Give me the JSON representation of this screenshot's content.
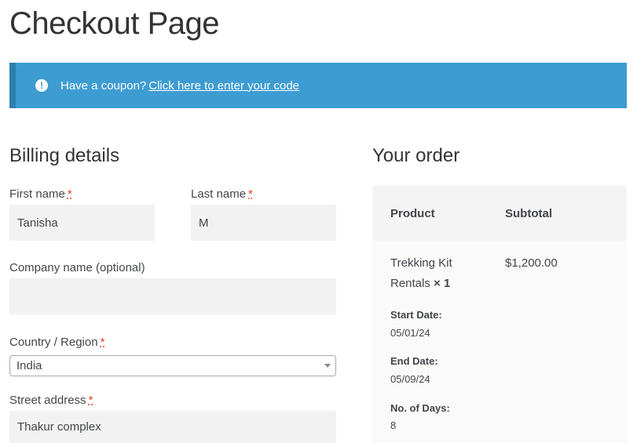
{
  "page": {
    "title": "Checkout Page"
  },
  "notice": {
    "icon": "exclamation-icon",
    "text": "Have a coupon?",
    "link": "Click here to enter your code",
    "bg_color": "#3d9cd2"
  },
  "billing": {
    "title": "Billing details",
    "required_marker": "*",
    "first_name": {
      "label": "First name",
      "value": "Tanisha"
    },
    "last_name": {
      "label": "Last name",
      "value": "M"
    },
    "company": {
      "label": "Company name (optional)",
      "value": ""
    },
    "country": {
      "label": "Country / Region",
      "value": "India"
    },
    "street": {
      "label": "Street address",
      "value": "Thakur complex"
    }
  },
  "order": {
    "title": "Your order",
    "headers": {
      "product": "Product",
      "subtotal": "Subtotal"
    },
    "item": {
      "name_line1": "Trekking Kit",
      "name_line2": "Rentals",
      "qty": "× 1",
      "subtotal": "$1,200.00",
      "start_label": "Start Date:",
      "start_value": "05/01/24",
      "end_label": "End Date:",
      "end_value": "05/09/24",
      "days_label": "No. of Days:",
      "days_value": "8"
    }
  }
}
